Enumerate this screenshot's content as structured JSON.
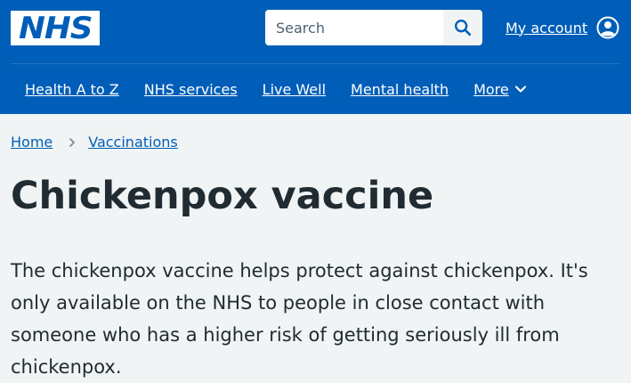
{
  "header": {
    "logo_text": "NHS",
    "search": {
      "placeholder": "Search"
    },
    "account_label": "My account",
    "icons": {
      "search": "search-icon",
      "account": "user-circle-icon",
      "more": "chevron-down-icon"
    },
    "nav": [
      {
        "label": "Health A to Z"
      },
      {
        "label": "NHS services"
      },
      {
        "label": "Live Well"
      },
      {
        "label": "Mental health"
      },
      {
        "label": "More"
      }
    ]
  },
  "breadcrumb": [
    {
      "label": "Home"
    },
    {
      "label": "Vaccinations"
    }
  ],
  "main": {
    "title": "Chickenpox vaccine",
    "lede": "The chickenpox vaccine helps protect against chickenpox. It's only available on the NHS to people in close contact with someone who has a higher risk of getting seriously ill from chickenpox."
  },
  "colors": {
    "brand_blue": "#005eb8",
    "page_background": "#f0f4f5",
    "text": "#212b32"
  }
}
